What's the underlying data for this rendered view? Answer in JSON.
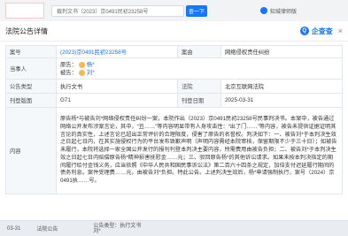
{
  "topbar": {
    "search_text": "裁判文书（2023）京0491民初23258号",
    "search_button": "查一下",
    "qcc_link": "知城律师版"
  },
  "modal": {
    "title": "法院公告详情",
    "brand_text": "企查查",
    "close": "×"
  },
  "detail": {
    "case_no_label": "案号",
    "case_no": "(2023)京0491民初23258号",
    "cause_label": "案由",
    "cause": "网络侵权责任纠纷",
    "parties_label": "当事人",
    "plaintiff_label": "原告：",
    "plaintiff": "杨*",
    "defendant_label": "被告：",
    "defendant": "刘*",
    "type_label": "公告类型",
    "type": "执行文书",
    "court_label": "法院",
    "court": "北京互联网法院",
    "page_label": "刊登版面",
    "page": "G71",
    "date_label": "刊登日期",
    "date": "2025-03-31",
    "content_label": "内容",
    "content": "原告杨*与被告刘*网络侵权责任纠纷一案，本院作出（2023）京0491民初23258号民事判决书。本案中，被告通过网络公开发布涉案言论，其中，“丑……”等内容明显带有人身攻击性：“出了门……”等内容，被告未提供证据证明其言论的真实性，上述言论已超出正常评价的合理限度，侵害了原告的名誉权。判决如下：一、被告刘*于本判决生效之日起七日内，在其实施侵权行为的平台发布致歉声明（声明内容需经本院审核，保留期限不少于三十日）；如被告未履行，本院将选择一家全国公开发行的报刊刊登本判决主要内容，所需费用由被告负担；二、被告刘*于本判决生效之日起七日内赔偿原告杨*精神损害抚慰金……元；三、驳回原告杨*的其他诉讼请求。如果未按本判决指定的期间履行给付金钱义务，应当依照《中华人民共和国民事诉讼法》第二百六十四条之规定，加倍支付迟延履行期间的债务利息。案件受理费……元，由被告刘*负担。特此公告。上述判决生效后，杨*申请强制执行，案号（2024）京0491执……号。"
  },
  "bottom": {
    "date": "03-31",
    "category": "法院公告",
    "info_type": "公告类型：执行文书",
    "info_party": "刘*"
  },
  "colors": {
    "accent": "#1677ff",
    "link": "#1a73e8"
  }
}
